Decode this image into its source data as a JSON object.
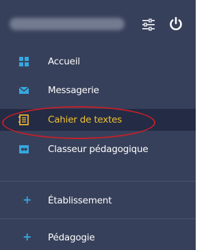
{
  "header": {
    "username": "",
    "settings_icon": "sliders-icon",
    "power_icon": "power-icon"
  },
  "menu": {
    "items": [
      {
        "label": "Accueil",
        "icon": "grid-icon",
        "icon_color": "#35a8df"
      },
      {
        "label": "Messagerie",
        "icon": "envelope-icon",
        "icon_color": "#35a8df"
      },
      {
        "label": "Cahier de textes",
        "icon": "notebook-icon",
        "icon_color": "#e8b333",
        "active": true
      },
      {
        "label": "Classeur pédagogique",
        "icon": "binder-icon",
        "icon_color": "#35a8df"
      }
    ],
    "sections": [
      {
        "label": "Établissement",
        "icon": "plus-icon"
      },
      {
        "label": "Pédagogie",
        "icon": "plus-icon"
      }
    ]
  },
  "colors": {
    "panel_bg": "#37405a",
    "active_bg": "#232b45",
    "active_text": "#f4c331",
    "accent": "#35a8df",
    "annotation": "#c42029"
  }
}
